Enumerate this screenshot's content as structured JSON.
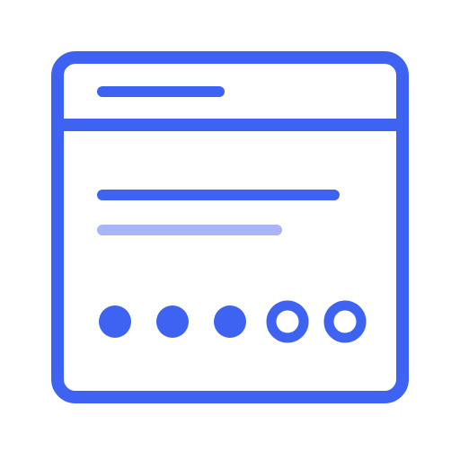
{
  "icon": {
    "name": "browser-window-password-progress-icon",
    "colors": {
      "primary": "#3e63f2",
      "secondary": "#a9b5f8",
      "background": "#ffffff"
    },
    "progress": {
      "filled": 3,
      "total": 5
    }
  }
}
